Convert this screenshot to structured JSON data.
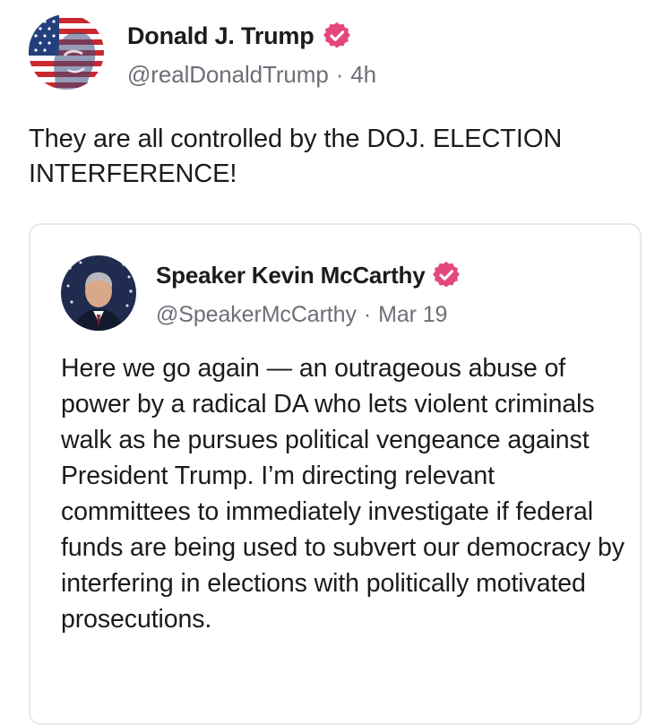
{
  "post": {
    "author": {
      "display_name": "Donald J. Trump",
      "handle": "@realDonaldTrump",
      "separator": "·",
      "time": "4h",
      "avatar_icon": "flag-portrait-avatar",
      "verified_icon": "verified-badge-icon"
    },
    "text": "They are all controlled by the DOJ. ELECTION INTERFERENCE!"
  },
  "quoted_post": {
    "author": {
      "display_name": "Speaker Kevin McCarthy",
      "handle": "@SpeakerMcCarthy",
      "separator": "·",
      "time": "Mar 19",
      "avatar_icon": "portrait-avatar",
      "verified_icon": "verified-badge-icon"
    },
    "text": "Here we go again — an outrageous abuse of power by a radical DA who lets violent criminals walk as he pursues political vengeance against President Trump. I’m directing relevant committees to immediately investigate if federal funds are being used to subvert our democracy by interfering in elections with politically motivated prosecutions."
  },
  "colors": {
    "text_primary": "#1b1b1f",
    "text_secondary": "#6e6e78",
    "verified_badge": "#e5477b",
    "card_border": "#e7e7ee"
  }
}
